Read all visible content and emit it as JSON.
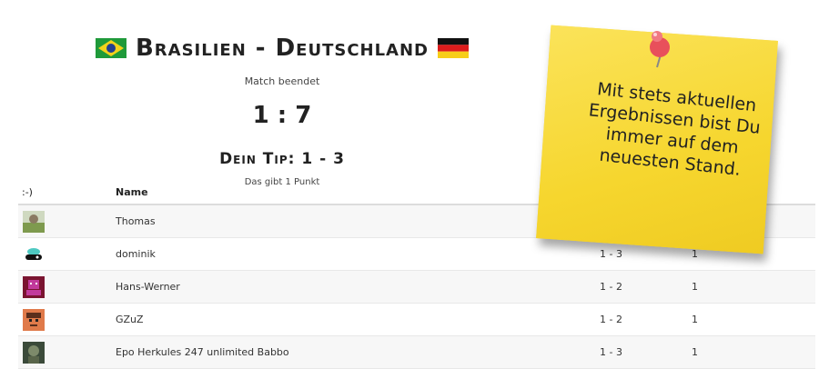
{
  "match": {
    "team_home": "Brasilien",
    "separator": "-",
    "team_away": "Deutschland",
    "status": "Match beendet",
    "score": "1 : 7",
    "tip": "Dein Tip: 1 - 3",
    "points_text": "Das gibt 1 Punkt"
  },
  "table": {
    "headers": {
      "avatar_col": ":-)",
      "name_col": "Name"
    },
    "rows": [
      {
        "name": "Thomas",
        "tip": "",
        "points": ""
      },
      {
        "name": "dominik",
        "tip": "1 - 3",
        "points": "1"
      },
      {
        "name": "Hans-Werner",
        "tip": "1 - 2",
        "points": "1"
      },
      {
        "name": "GZuZ",
        "tip": "1 - 2",
        "points": "1"
      },
      {
        "name": "Epo Herkules 247 unlimited Babbo",
        "tip": "1 - 3",
        "points": "1"
      }
    ]
  },
  "sticky_note": {
    "text": "Mit stets aktuellen Ergebnissen bist Du immer auf dem neuesten Stand."
  },
  "icons": [
    "brazil-flag-icon",
    "germany-flag-icon",
    "pushpin-icon"
  ],
  "colors": {
    "note": "#f9dc3c",
    "pin": "#e8505b",
    "brazil_green": "#1f9a3a",
    "brazil_yellow": "#f2d21b"
  }
}
